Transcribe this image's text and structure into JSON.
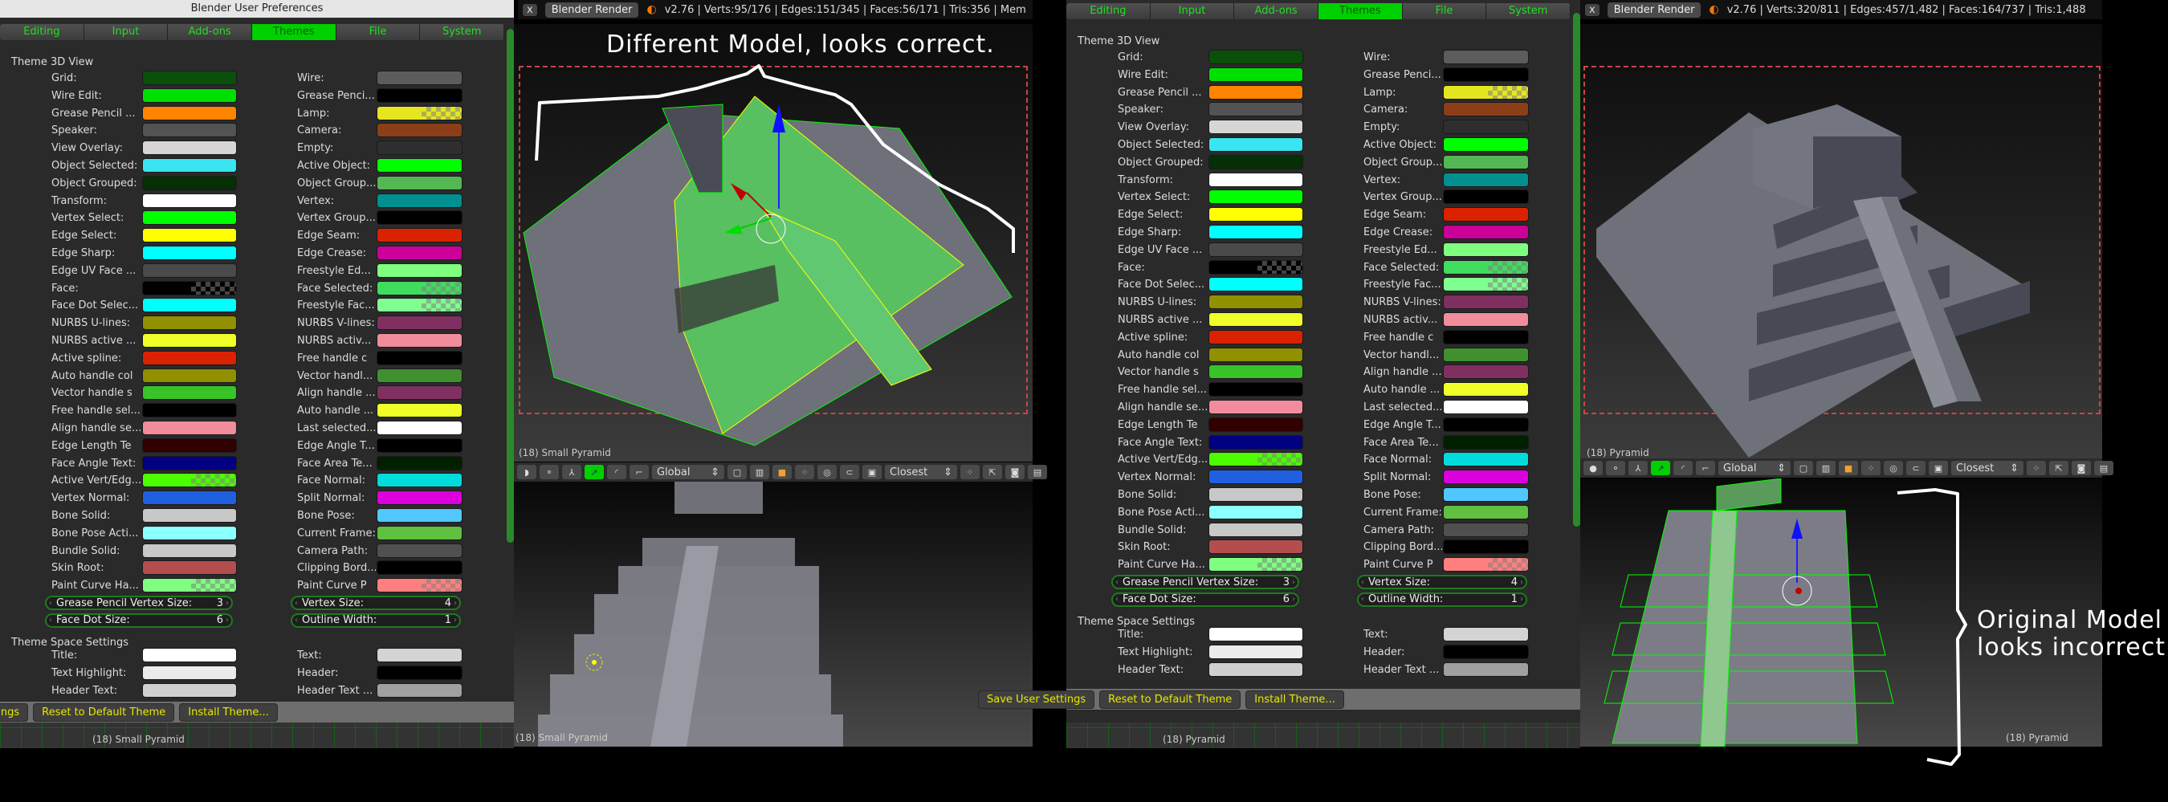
{
  "annotations": {
    "top": "Different Model, looks correct.",
    "right_line1": "Original Model",
    "right_line2": "looks incorrect"
  },
  "screenshots": [
    {
      "prefs_title": "Blender User Preferences",
      "infobar": {
        "close_label": "x",
        "engine": "Blender Render",
        "stats": "v2.76 | Verts:95/176 | Edges:151/345 | Faces:56/171 | Tris:356 | Mem"
      },
      "viewport_top_label": "(18) Small Pyramid",
      "viewport_bottom_label": "(18) Small Pyramid",
      "strip_label": "(18) Small Pyramid"
    },
    {
      "prefs_title": "",
      "infobar": {
        "close_label": "x",
        "engine": "Blender Render",
        "stats": "v2.76 | Verts:320/811 | Edges:457/1,482 | Faces:164/737 | Tris:1,488"
      },
      "viewport_top_label": "(18) Pyramid",
      "viewport_bottom_label": "(18) Pyramid",
      "strip_label": "(18) Pyramid"
    }
  ],
  "tabs": [
    {
      "label": "Editing",
      "active": false
    },
    {
      "label": "Input",
      "active": false
    },
    {
      "label": "Add-ons",
      "active": false
    },
    {
      "label": "Themes",
      "active": true
    },
    {
      "label": "File",
      "active": false
    },
    {
      "label": "System",
      "active": false
    }
  ],
  "sections": {
    "view3d": "Theme 3D View",
    "space": "Theme Space Settings"
  },
  "theme_left": [
    {
      "label": "Grid:",
      "color": "#0a500a"
    },
    {
      "label": "Wire Edit:",
      "color": "#00e000"
    },
    {
      "label": "Grease Pencil ...",
      "color": "#ff8500"
    },
    {
      "label": "Speaker:",
      "color": "#535353"
    },
    {
      "label": "View Overlay:",
      "color": "#d6d6d6"
    },
    {
      "label": "Object Selected:",
      "color": "#3ae4f0"
    },
    {
      "label": "Object Grouped:",
      "color": "#062f06"
    },
    {
      "label": "Transform:",
      "color": "#ffffff"
    },
    {
      "label": "Vertex Select:",
      "color": "#00ff00"
    },
    {
      "label": "Edge Select:",
      "color": "#ffff00"
    },
    {
      "label": "Edge Sharp:",
      "color": "#00ffff"
    },
    {
      "label": "Edge UV Face ...",
      "color": "#4a4a4a"
    },
    {
      "label": "Face:",
      "color": "#000000",
      "alpha": true
    },
    {
      "label": "Face Dot Selec...",
      "color": "#00ffff"
    },
    {
      "label": "NURBS U-lines:",
      "color": "#909000"
    },
    {
      "label": "NURBS active ...",
      "color": "#f0ff28"
    },
    {
      "label": "Active spline:",
      "color": "#db2200"
    },
    {
      "label": "Auto handle col",
      "color": "#909000"
    },
    {
      "label": "Vector handle s",
      "color": "#38c428"
    },
    {
      "label": "Free handle sel...",
      "color": "#000000"
    },
    {
      "label": "Align handle se...",
      "color": "#f08c9c"
    },
    {
      "label": "Edge Length Te",
      "color": "#320000"
    },
    {
      "label": "Face Angle Text:",
      "color": "#000080"
    },
    {
      "label": "Active Vert/Edg...",
      "color": "#4bff00",
      "alpha": true
    },
    {
      "label": "Vertex Normal:",
      "color": "#2060e0"
    },
    {
      "label": "Bone Solid:",
      "color": "#c8c8c8"
    },
    {
      "label": "Bone Pose Acti...",
      "color": "#8cffff"
    },
    {
      "label": "Bundle Solid:",
      "color": "#c8c8c8"
    },
    {
      "label": "Skin Root:",
      "color": "#b44e4e"
    },
    {
      "label": "Paint Curve Ha...",
      "color": "#7fff7f",
      "alpha": true
    }
  ],
  "theme_right": [
    {
      "label": "Wire:",
      "color": "#5c5c5c"
    },
    {
      "label": "Grease Penci...",
      "color": "#000000"
    },
    {
      "label": "Lamp:",
      "color": "#e6e620",
      "alpha": true
    },
    {
      "label": "Camera:",
      "color": "#8b3e17"
    },
    {
      "label": "Empty:",
      "color": "#2e2e2e"
    },
    {
      "label": "Active Object:",
      "color": "#00ff00"
    },
    {
      "label": "Object Group...",
      "color": "#53b853"
    },
    {
      "label": "Vertex:",
      "color": "#009090"
    },
    {
      "label": "Vertex Group...",
      "color": "#000000"
    },
    {
      "label": "Edge Seam:",
      "color": "#db2200"
    },
    {
      "label": "Edge Crease:",
      "color": "#cc0099"
    },
    {
      "label": "Freestyle Ed...",
      "color": "#7fff7f"
    },
    {
      "label": "Face Selected:",
      "color": "#3fdc5e",
      "alpha": true
    },
    {
      "label": "Freestyle Fac...",
      "color": "#7fff8f",
      "alpha": true
    },
    {
      "label": "NURBS V-lines:",
      "color": "#803060"
    },
    {
      "label": "NURBS activ...",
      "color": "#f08c9c"
    },
    {
      "label": "Free handle c",
      "color": "#000000"
    },
    {
      "label": "Vector handl...",
      "color": "#409030"
    },
    {
      "label": "Align handle ...",
      "color": "#803060"
    },
    {
      "label": "Auto handle ...",
      "color": "#f0ff28"
    },
    {
      "label": "Last selected...",
      "color": "#ffffff"
    },
    {
      "label": "Edge Angle T...",
      "color": "#000000"
    },
    {
      "label": "Face Area Te...",
      "color": "#002000"
    },
    {
      "label": "Face Normal:",
      "color": "#00dcdc"
    },
    {
      "label": "Split Normal:",
      "color": "#dc00dc"
    },
    {
      "label": "Bone Pose:",
      "color": "#50c8ff"
    },
    {
      "label": "Current Frame:",
      "color": "#60c040"
    },
    {
      "label": "Camera Path:",
      "color": "#505050"
    },
    {
      "label": "Clipping Bord...",
      "color": "#000000"
    },
    {
      "label": "Paint Curve P",
      "color": "#ff7f7f",
      "alpha": true
    }
  ],
  "numeric_fields": [
    {
      "label": "Grease Pencil Vertex Size:",
      "value": "3"
    },
    {
      "label": "Vertex Size:",
      "value": "4"
    },
    {
      "label": "Face Dot Size:",
      "value": "6"
    },
    {
      "label": "Outline Width:",
      "value": "1"
    }
  ],
  "space_left": [
    {
      "label": "Title:",
      "color": "#ffffff"
    },
    {
      "label": "Text Highlight:",
      "color": "#ebebeb"
    },
    {
      "label": "Header Text:",
      "color": "#d0d0d0"
    }
  ],
  "space_right": [
    {
      "label": "Text:",
      "color": "#d4d4d4"
    },
    {
      "label": "Header:",
      "color": "#000000"
    },
    {
      "label": "Header Text ...",
      "color": "#a0a0a0"
    }
  ],
  "bottom_buttons": [
    {
      "label": "Save User Settings"
    },
    {
      "label": "Reset to Default Theme"
    },
    {
      "label": "Install Theme..."
    }
  ],
  "view_header": {
    "orientation": "Global",
    "snap_target": "Closest"
  }
}
